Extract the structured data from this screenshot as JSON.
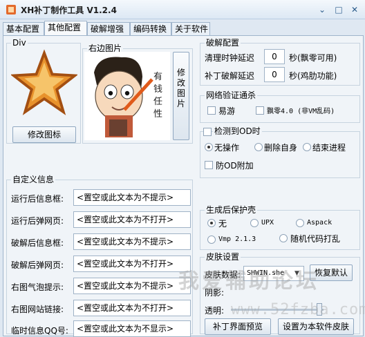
{
  "window": {
    "title": "XH补丁制作工具 V1.2.4",
    "min": "⌄",
    "max": "□",
    "close": "✕"
  },
  "tabs": [
    "基本配置",
    "其他配置",
    "破解增强",
    "编码转换",
    "关于软件"
  ],
  "div_group": {
    "title": "Div",
    "button": "修改图标"
  },
  "right_image": {
    "title": "右边图片",
    "button": "修改图片",
    "caption": "有钱任性"
  },
  "custom_info": {
    "title": "自定义信息",
    "rows": [
      {
        "label": "运行后信息框:",
        "value": "<置空或此文本为不提示>"
      },
      {
        "label": "运行后弹网页:",
        "value": "<置空或此文本为不打开>"
      },
      {
        "label": "破解后信息框:",
        "value": "<置空或此文本为不提示>"
      },
      {
        "label": "破解后弹网页:",
        "value": "<置空或此文本为不打开>"
      },
      {
        "label": "右图气泡提示:",
        "value": "<置空或此文本为不提示>"
      },
      {
        "label": "右图网站链接:",
        "value": "<置空或此文本为不打开>"
      },
      {
        "label": "临时信息QQ号:",
        "value": "<置空或此文本为不显示>"
      }
    ]
  },
  "crack_config": {
    "title": "破解配置",
    "clear_label": "清理时钟延迟",
    "clear_value": "0",
    "clear_unit": "秒(飘零可用)",
    "patch_label": "补丁破解延迟",
    "patch_value": "0",
    "patch_unit": "秒(鸡肋功能)"
  },
  "network": {
    "title": "网络验证通杀",
    "opt1": "易游",
    "opt2": "飘零4.0 (非VM乱码)"
  },
  "od": {
    "title": "检测到OD时",
    "opt1": "无操作",
    "opt2": "删除自身",
    "opt3": "结束进程",
    "extra": "防OD附加"
  },
  "shell": {
    "title": "生成后保护壳",
    "opt1": "无",
    "opt2": "UPX",
    "opt3": "Aspack",
    "opt4": "Vmp 2.1.3",
    "opt5": "随机代码打乱"
  },
  "skin": {
    "title": "皮肤设置",
    "data_label": "皮肤数据:",
    "data_value": "SHWIN.she",
    "restore_button": "恢复默认",
    "shadow_label": "阴影:",
    "transparency_label": "透明:",
    "preview_button": "补丁界面预览",
    "set_button": "设置为本软件皮肤"
  },
  "watermark": {
    "text": "我爱辅助论坛",
    "url": "www.52fzba.com"
  }
}
